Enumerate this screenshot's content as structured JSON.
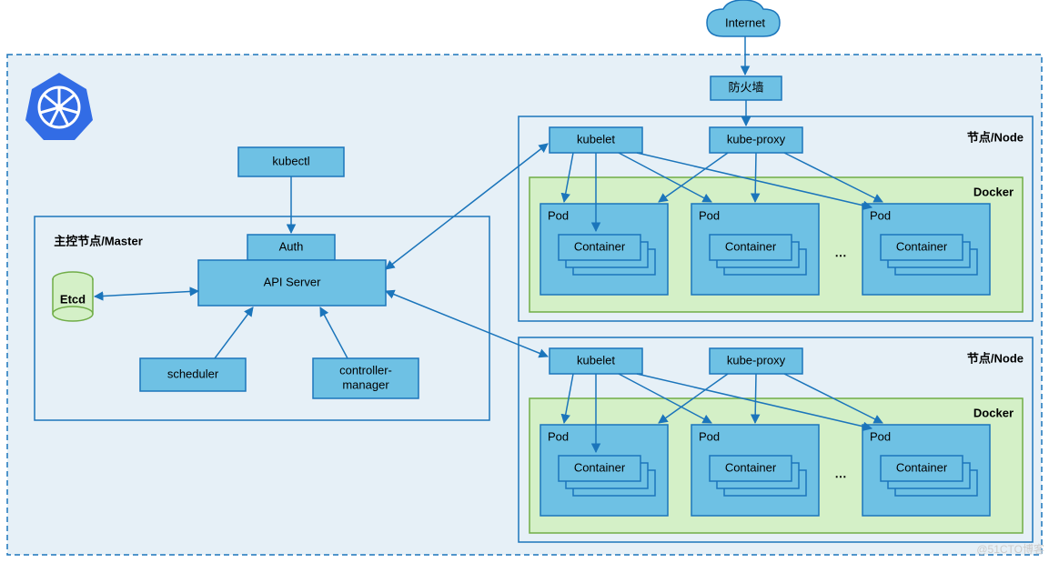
{
  "internet": "Internet",
  "firewall": "防火墙",
  "kubectl": "kubectl",
  "master": {
    "title": "主控节点/Master",
    "auth": "Auth",
    "api": "API Server",
    "etcd": "Etcd",
    "scheduler": "scheduler",
    "controller": "controller-\nmanager"
  },
  "node": {
    "title": "节点/Node",
    "kubelet": "kubelet",
    "kubeproxy": "kube-proxy",
    "docker": "Docker",
    "pod": "Pod",
    "container": "Container",
    "ellipsis": "⋯"
  },
  "logo": "kubernetes-icon",
  "watermark": "@51CTO博客"
}
